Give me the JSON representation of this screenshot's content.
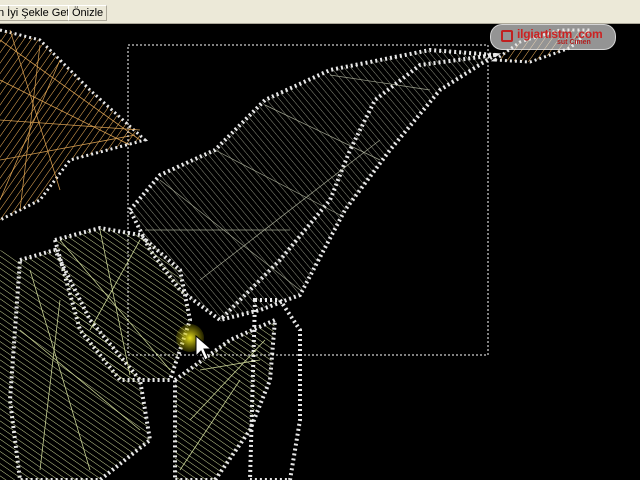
{
  "toolbar": {
    "best_fit_label": "n İyi Şekle Getir",
    "preview_label": "Önizle"
  },
  "watermark": {
    "site_text": "ilgiartistm .com",
    "credit_text": "sut Cimen"
  },
  "colors": {
    "background": "#000000",
    "toolbar": "#ece9d8",
    "orange_thread": "#f0b15a",
    "pale_green_thread": "#dbe6a2",
    "gray_green_thread": "#c4c8b0",
    "stitch_border": "#e8e8e8",
    "cursor_highlight": "#d8d000"
  },
  "icons": {
    "watermark_logo": "square-logo-icon",
    "cursor": "arrow-pointer-icon"
  }
}
